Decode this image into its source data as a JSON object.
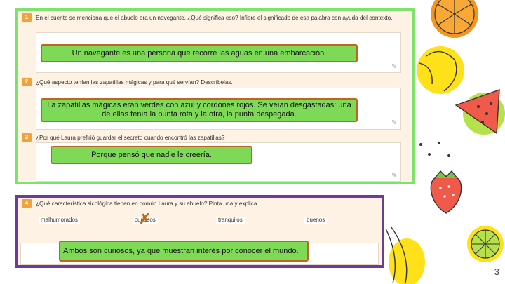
{
  "question1": {
    "number": "1",
    "text": "En el cuento se menciona que el abuelo era un navegante. ¿Qué significa eso? Infiere el significado de esa palabra con ayuda del contexto.",
    "answer": "Un navegante es una persona que recorre las aguas en una embarcación."
  },
  "question2": {
    "number": "2",
    "text": "¿Qué aspecto tenían las zapatillas mágicas y para qué servían? Descríbelas.",
    "answer": "La zapatillas mágicas eran verdes con azul y cordones rojos. Se veían desgastadas: una de ellas tenía la punta rota y la otra, la punta despegada."
  },
  "question3": {
    "number": "3",
    "text": "¿Por qué Laura prefirió guardar el secreto cuando encontró las zapatillas?",
    "answer": "Porque pensó que nadie le creería."
  },
  "question4": {
    "number": "4",
    "text": "¿Qué característica sicológica tienen en común Laura y su abuelo? Pinta una y explica.",
    "options": [
      "malhumorados",
      "curiosos",
      "tranquilos",
      "buenos"
    ],
    "selected_mark": "✗",
    "answer": "Ambos son curiosos, ya que muestran interés por conocer el mundo."
  },
  "page_number": "3",
  "colors": {
    "green_border": "#7de36a",
    "purple_border": "#6e3c95",
    "callout_fill": "#7ed957",
    "callout_border": "#c0641f",
    "question_badge": "#f2a23a",
    "panel_bg": "#fdf2e3"
  },
  "icons": [
    "pencil-icon",
    "x-mark-icon"
  ]
}
